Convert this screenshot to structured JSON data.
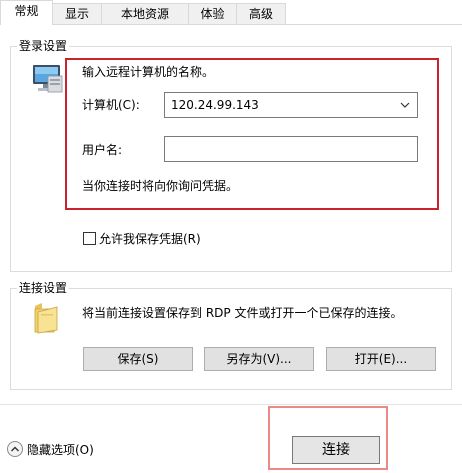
{
  "tabs": [
    {
      "label": "常规",
      "active": true
    },
    {
      "label": "显示",
      "active": false
    },
    {
      "label": "本地资源",
      "active": false
    },
    {
      "label": "体验",
      "active": false
    },
    {
      "label": "高级",
      "active": false
    }
  ],
  "login": {
    "group_title": "登录设置",
    "prompt": "输入远程计算机的名称。",
    "computer_label": "计算机(C):",
    "computer_value": "120.24.99.143",
    "username_label": "用户名:",
    "username_value": "",
    "hint": "当你连接时将向你询问凭据。",
    "save_credentials_label": "允许我保存凭据(R)",
    "save_credentials_checked": false
  },
  "connection": {
    "group_title": "连接设置",
    "description": "将当前连接设置保存到 RDP 文件或打开一个已保存的连接。",
    "save_label": "保存(S)",
    "save_as_label": "另存为(V)...",
    "open_label": "打开(E)..."
  },
  "footer": {
    "hide_options_label": "隐藏选项(O)",
    "connect_label": "连接"
  },
  "colors": {
    "highlight": "#c9242c",
    "connect_highlight": "#e98a86"
  }
}
